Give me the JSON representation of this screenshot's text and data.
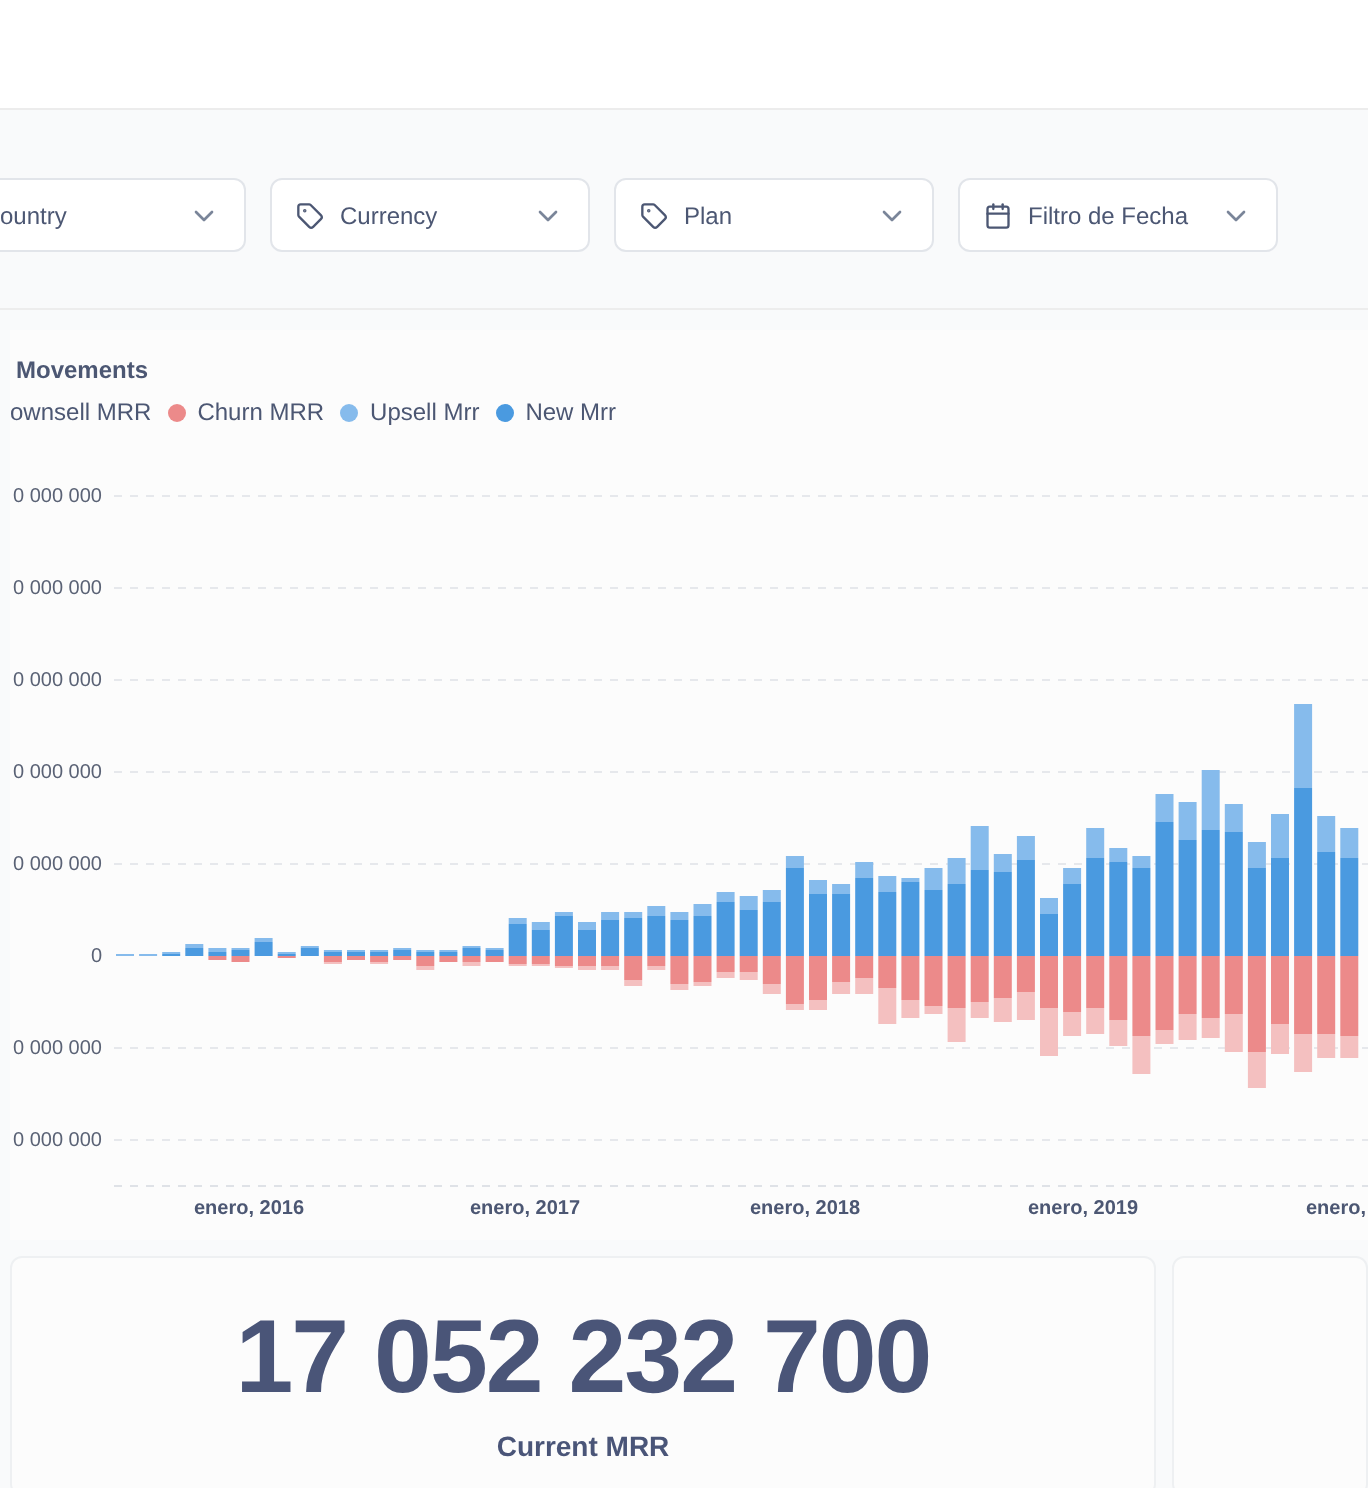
{
  "filters": [
    {
      "label": "ountry",
      "kind": "plain"
    },
    {
      "label": "Currency",
      "kind": "category"
    },
    {
      "label": "Plan",
      "kind": "category"
    },
    {
      "label": "Filtro de Fecha",
      "kind": "date"
    }
  ],
  "chart": {
    "title": "Movements",
    "legend": [
      {
        "label": "ownsell MRR"
      },
      {
        "label": "Churn MRR",
        "color": "#ec8a8a"
      },
      {
        "label": "Upsell Mrr",
        "color": "#86bbec"
      },
      {
        "label": "New Mrr",
        "color": "#4a9ae0"
      }
    ],
    "y_labels": [
      "0 000 000",
      "0 000 000",
      "0 000 000",
      "0 000 000",
      "0 000 000",
      "0",
      "0 000 000",
      "0 000 000"
    ],
    "x_labels": [
      "enero, 2016",
      "enero, 2017",
      "enero, 2018",
      "enero, 2019",
      "enero,"
    ]
  },
  "kpi": {
    "value": "17 052 232 700",
    "label": "Current MRR"
  }
}
